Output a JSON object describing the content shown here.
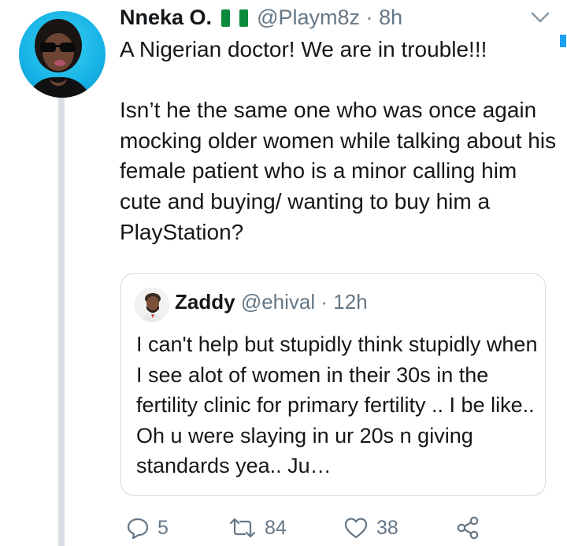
{
  "tweet": {
    "author_name": "Nneka O.",
    "author_handle": "@Playm8z",
    "separator": "·",
    "time": "8h",
    "flag_icon": "nigeria-flag-icon",
    "text": "A Nigerian doctor! We are in trouble!!!\n\nIsn’t he the same one who was once again mocking older women while talking about his female patient who is a minor calling him cute and buying/ wanting to buy him a PlayStation?"
  },
  "quoted_tweet": {
    "author_name": "Zaddy",
    "author_handle": "@ehival",
    "separator": "·",
    "time": "12h",
    "text": "I can't help but stupidly think stupidly when I see alot of women in their 30s in the fertility clinic for primary fertility .. I be like.. Oh u were slaying in ur 20s n giving standards yea.. Ju…"
  },
  "actions": {
    "replies": "5",
    "retweets": "84",
    "likes": "38"
  },
  "colors": {
    "text": "#14171a",
    "muted": "#657786",
    "icon": "#8899a6",
    "accent": "#1da1f2",
    "thread_line": "#d9dfe4"
  }
}
